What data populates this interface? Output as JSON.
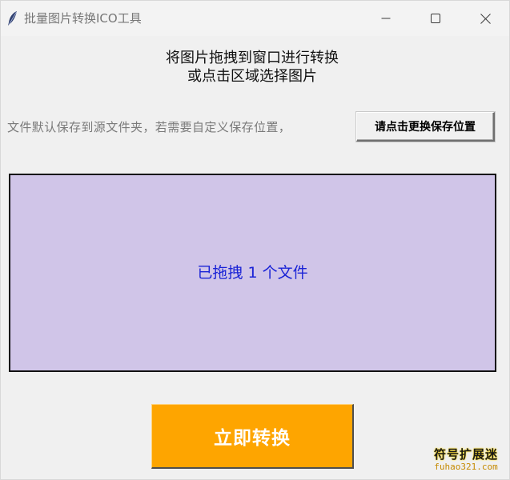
{
  "window": {
    "title": "批量图片转换ICO工具",
    "icon": "feather-icon",
    "controls": {
      "minimize_icon": "minimize-icon",
      "maximize_icon": "maximize-icon",
      "close_icon": "close-icon"
    }
  },
  "instruction": {
    "line1": "将图片拖拽到窗口进行转换",
    "line2": "或点击区域选择图片"
  },
  "save_location": {
    "note": "文件默认保存到源文件夹，若需要自定义保存位置，",
    "button_label": "请点击更换保存位置"
  },
  "drop_zone": {
    "status": "已拖拽 1 个文件",
    "background_color": "#d0c5e8",
    "text_color": "#1a23d6"
  },
  "convert": {
    "button_label": "立即转换",
    "background_color": "#fea500"
  },
  "watermark": {
    "main": "符号扩展迷",
    "sub": "fuhao321.com"
  }
}
